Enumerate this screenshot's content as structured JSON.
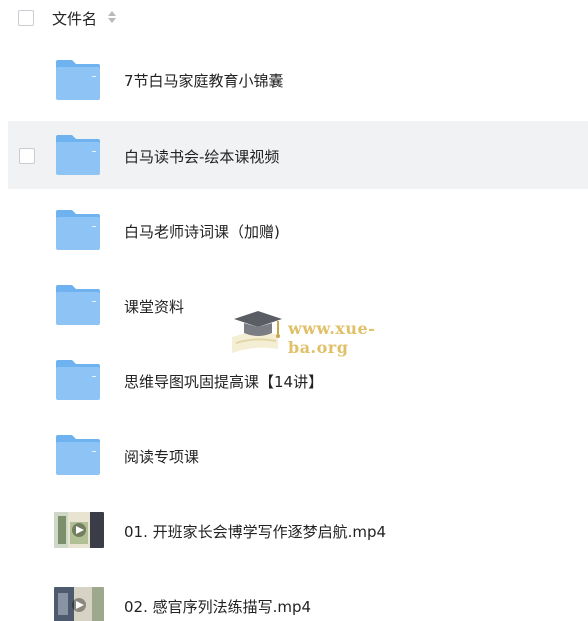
{
  "header": {
    "column_name": "文件名",
    "sort_icon": "sort-updown-icon"
  },
  "files": [
    {
      "name": "7节白马家庭教育小锦囊",
      "type": "folder"
    },
    {
      "name": "白马读书会-绘本课视频",
      "type": "folder",
      "hovered": true
    },
    {
      "name": "白马老师诗词课（加赠)",
      "type": "folder"
    },
    {
      "name": "课堂资料",
      "type": "folder"
    },
    {
      "name": "思维导图巩固提高课【14讲】",
      "type": "folder"
    },
    {
      "name": "阅读专项课",
      "type": "folder"
    },
    {
      "name": "01. 开班家长会博学写作逐梦启航.mp4",
      "type": "video"
    },
    {
      "name": "02. 感官序列法练描写.mp4",
      "type": "video"
    }
  ],
  "watermark": {
    "text": "www.xue-ba.org",
    "icon": "graduation-cap-icon"
  },
  "colors": {
    "folder": "#8dc4f5",
    "folder_back": "#6eb2ef",
    "hover_row": "#f1f2f4",
    "watermark_text": "#e0c068"
  }
}
